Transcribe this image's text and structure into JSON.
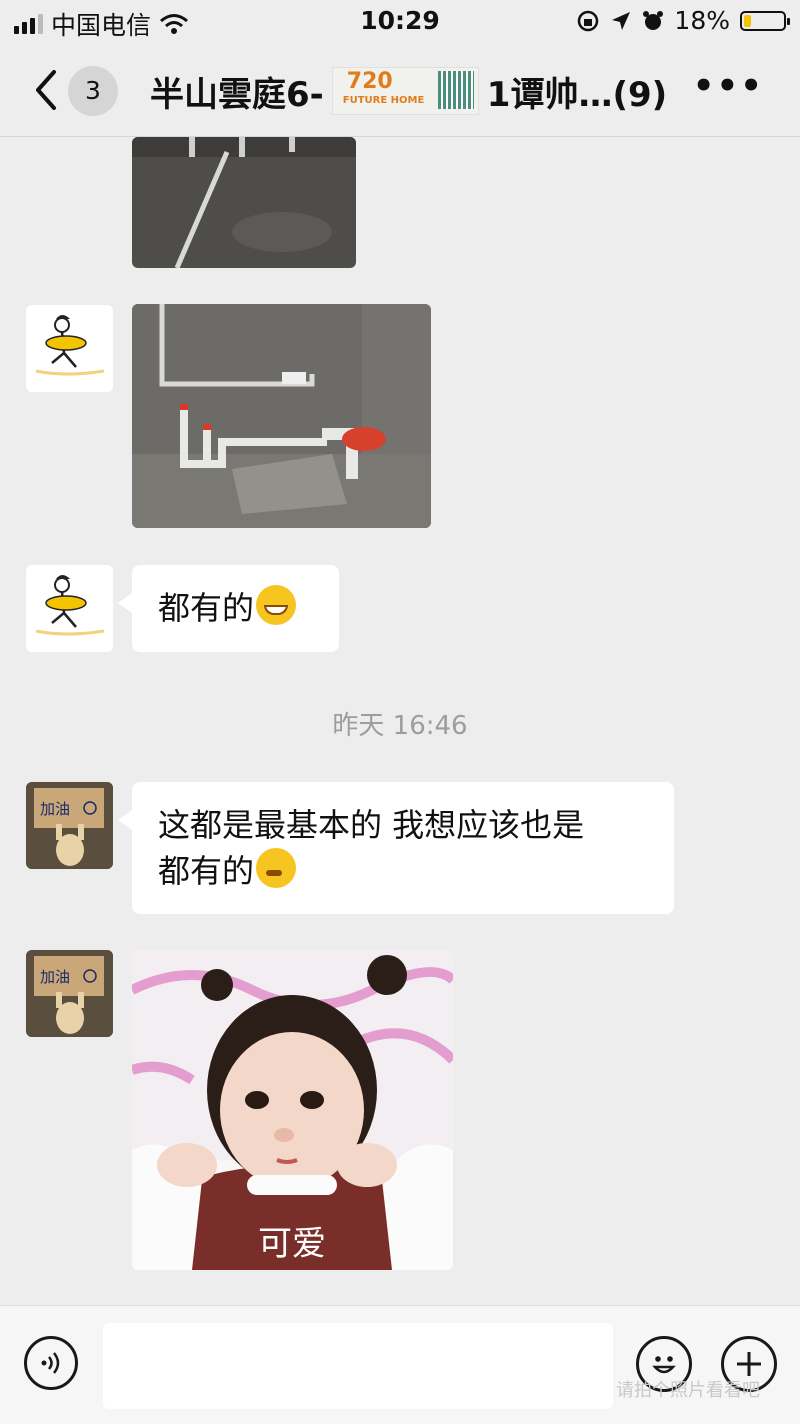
{
  "status_bar": {
    "carrier": "中国电信",
    "time": "10:29",
    "battery": "18%",
    "battery_level": 0.18
  },
  "nav": {
    "unread_count": "3",
    "title_prefix": "半山雲庭6-",
    "title_suffix": "1谭帅…(9)",
    "ad_number": "720",
    "ad_brand": "FUTURE HOME",
    "more": "•••"
  },
  "messages": [
    {
      "type": "image",
      "sender": "avatar-runner",
      "description": "bathroom-photo-top-cropped"
    },
    {
      "type": "image",
      "sender": "avatar-runner",
      "description": "bathroom-pipes-photo"
    },
    {
      "type": "text",
      "sender": "avatar-runner",
      "text": "都有的",
      "emoji": "grinning-emoji"
    },
    {
      "type": "timestamp",
      "text": "昨天 16:46"
    },
    {
      "type": "text",
      "sender": "avatar-jiayou",
      "line1": "这都是最基本的 我想应该也是",
      "line2": "都有的",
      "emoji": "thinking-emoji"
    },
    {
      "type": "sticker",
      "sender": "avatar-jiayou",
      "caption": "可爱"
    }
  ],
  "avatar_label": "加油",
  "input_bar": {
    "voice_icon": "voice-icon",
    "emoji_icon": "emoji-icon",
    "plus_icon": "plus-icon"
  },
  "watermark": "请拍个照片看看吧"
}
